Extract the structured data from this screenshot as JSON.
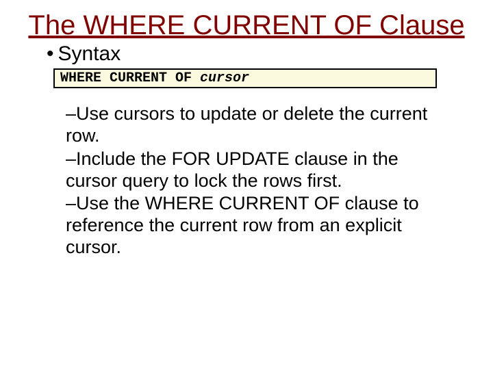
{
  "title": "The WHERE CURRENT OF Clause",
  "syntaxLabel": "Syntax",
  "codePrefix": "WHERE CURRENT OF ",
  "codeCursor": "cursor",
  "bullet": "•",
  "dash": "–",
  "items": [
    "Use cursors to update or delete the current row.",
    "Include the FOR UPDATE clause in the cursor query to lock the rows first.",
    "Use the WHERE CURRENT OF clause to reference the current row from an explicit cursor."
  ]
}
